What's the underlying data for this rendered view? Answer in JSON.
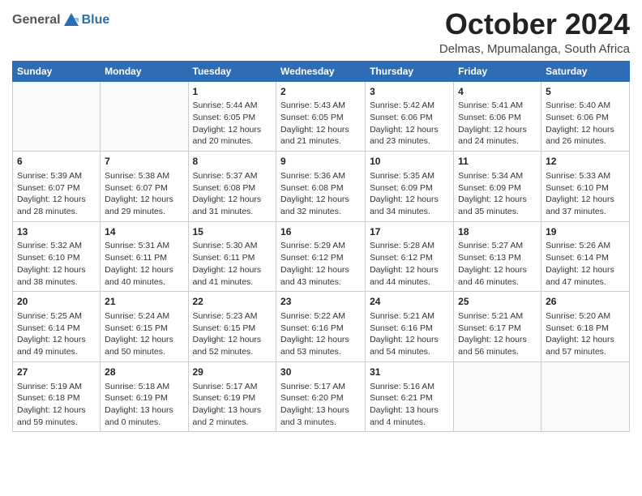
{
  "logo": {
    "general": "General",
    "blue": "Blue"
  },
  "header": {
    "month": "October 2024",
    "location": "Delmas, Mpumalanga, South Africa"
  },
  "weekdays": [
    "Sunday",
    "Monday",
    "Tuesday",
    "Wednesday",
    "Thursday",
    "Friday",
    "Saturday"
  ],
  "weeks": [
    [
      {
        "day": "",
        "info": ""
      },
      {
        "day": "",
        "info": ""
      },
      {
        "day": "1",
        "info": "Sunrise: 5:44 AM\nSunset: 6:05 PM\nDaylight: 12 hours and 20 minutes."
      },
      {
        "day": "2",
        "info": "Sunrise: 5:43 AM\nSunset: 6:05 PM\nDaylight: 12 hours and 21 minutes."
      },
      {
        "day": "3",
        "info": "Sunrise: 5:42 AM\nSunset: 6:06 PM\nDaylight: 12 hours and 23 minutes."
      },
      {
        "day": "4",
        "info": "Sunrise: 5:41 AM\nSunset: 6:06 PM\nDaylight: 12 hours and 24 minutes."
      },
      {
        "day": "5",
        "info": "Sunrise: 5:40 AM\nSunset: 6:06 PM\nDaylight: 12 hours and 26 minutes."
      }
    ],
    [
      {
        "day": "6",
        "info": "Sunrise: 5:39 AM\nSunset: 6:07 PM\nDaylight: 12 hours and 28 minutes."
      },
      {
        "day": "7",
        "info": "Sunrise: 5:38 AM\nSunset: 6:07 PM\nDaylight: 12 hours and 29 minutes."
      },
      {
        "day": "8",
        "info": "Sunrise: 5:37 AM\nSunset: 6:08 PM\nDaylight: 12 hours and 31 minutes."
      },
      {
        "day": "9",
        "info": "Sunrise: 5:36 AM\nSunset: 6:08 PM\nDaylight: 12 hours and 32 minutes."
      },
      {
        "day": "10",
        "info": "Sunrise: 5:35 AM\nSunset: 6:09 PM\nDaylight: 12 hours and 34 minutes."
      },
      {
        "day": "11",
        "info": "Sunrise: 5:34 AM\nSunset: 6:09 PM\nDaylight: 12 hours and 35 minutes."
      },
      {
        "day": "12",
        "info": "Sunrise: 5:33 AM\nSunset: 6:10 PM\nDaylight: 12 hours and 37 minutes."
      }
    ],
    [
      {
        "day": "13",
        "info": "Sunrise: 5:32 AM\nSunset: 6:10 PM\nDaylight: 12 hours and 38 minutes."
      },
      {
        "day": "14",
        "info": "Sunrise: 5:31 AM\nSunset: 6:11 PM\nDaylight: 12 hours and 40 minutes."
      },
      {
        "day": "15",
        "info": "Sunrise: 5:30 AM\nSunset: 6:11 PM\nDaylight: 12 hours and 41 minutes."
      },
      {
        "day": "16",
        "info": "Sunrise: 5:29 AM\nSunset: 6:12 PM\nDaylight: 12 hours and 43 minutes."
      },
      {
        "day": "17",
        "info": "Sunrise: 5:28 AM\nSunset: 6:12 PM\nDaylight: 12 hours and 44 minutes."
      },
      {
        "day": "18",
        "info": "Sunrise: 5:27 AM\nSunset: 6:13 PM\nDaylight: 12 hours and 46 minutes."
      },
      {
        "day": "19",
        "info": "Sunrise: 5:26 AM\nSunset: 6:14 PM\nDaylight: 12 hours and 47 minutes."
      }
    ],
    [
      {
        "day": "20",
        "info": "Sunrise: 5:25 AM\nSunset: 6:14 PM\nDaylight: 12 hours and 49 minutes."
      },
      {
        "day": "21",
        "info": "Sunrise: 5:24 AM\nSunset: 6:15 PM\nDaylight: 12 hours and 50 minutes."
      },
      {
        "day": "22",
        "info": "Sunrise: 5:23 AM\nSunset: 6:15 PM\nDaylight: 12 hours and 52 minutes."
      },
      {
        "day": "23",
        "info": "Sunrise: 5:22 AM\nSunset: 6:16 PM\nDaylight: 12 hours and 53 minutes."
      },
      {
        "day": "24",
        "info": "Sunrise: 5:21 AM\nSunset: 6:16 PM\nDaylight: 12 hours and 54 minutes."
      },
      {
        "day": "25",
        "info": "Sunrise: 5:21 AM\nSunset: 6:17 PM\nDaylight: 12 hours and 56 minutes."
      },
      {
        "day": "26",
        "info": "Sunrise: 5:20 AM\nSunset: 6:18 PM\nDaylight: 12 hours and 57 minutes."
      }
    ],
    [
      {
        "day": "27",
        "info": "Sunrise: 5:19 AM\nSunset: 6:18 PM\nDaylight: 12 hours and 59 minutes."
      },
      {
        "day": "28",
        "info": "Sunrise: 5:18 AM\nSunset: 6:19 PM\nDaylight: 13 hours and 0 minutes."
      },
      {
        "day": "29",
        "info": "Sunrise: 5:17 AM\nSunset: 6:19 PM\nDaylight: 13 hours and 2 minutes."
      },
      {
        "day": "30",
        "info": "Sunrise: 5:17 AM\nSunset: 6:20 PM\nDaylight: 13 hours and 3 minutes."
      },
      {
        "day": "31",
        "info": "Sunrise: 5:16 AM\nSunset: 6:21 PM\nDaylight: 13 hours and 4 minutes."
      },
      {
        "day": "",
        "info": ""
      },
      {
        "day": "",
        "info": ""
      }
    ]
  ]
}
